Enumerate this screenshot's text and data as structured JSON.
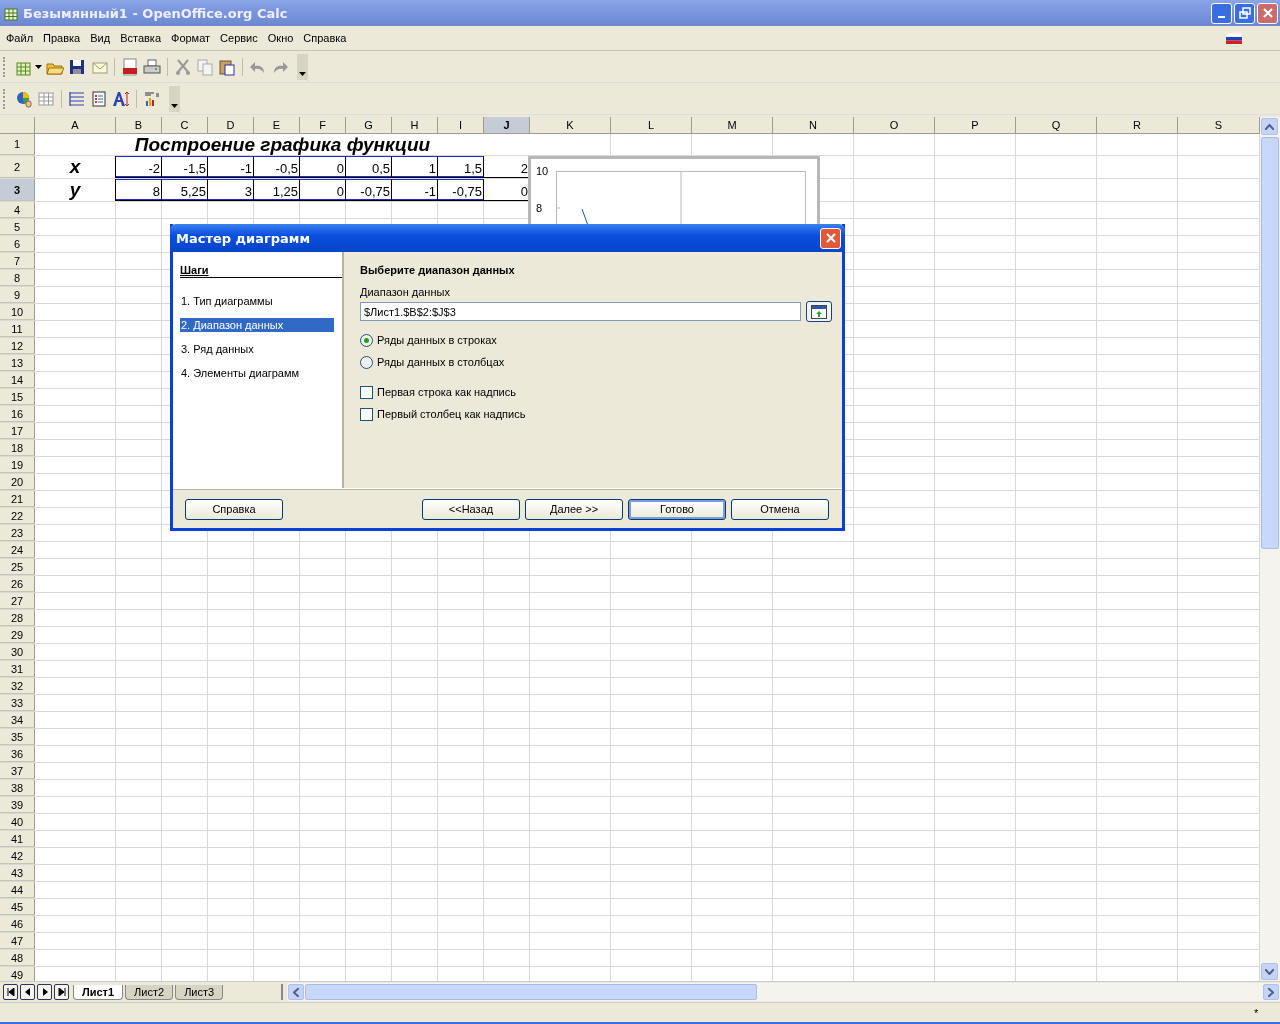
{
  "window": {
    "title": "Безымянный1 - OpenOffice.org Calc"
  },
  "menu": [
    "Файл",
    "Правка",
    "Вид",
    "Вставка",
    "Формат",
    "Сервис",
    "Окно",
    "Справка"
  ],
  "sheet": {
    "columns": [
      {
        "label": "A",
        "selected": false
      },
      {
        "label": "B",
        "selected": false
      },
      {
        "label": "C",
        "selected": false
      },
      {
        "label": "D",
        "selected": false
      },
      {
        "label": "E",
        "selected": false
      },
      {
        "label": "F",
        "selected": false
      },
      {
        "label": "G",
        "selected": false
      },
      {
        "label": "H",
        "selected": false
      },
      {
        "label": "I",
        "selected": false
      },
      {
        "label": "J",
        "selected": true
      },
      {
        "label": "K",
        "selected": false
      },
      {
        "label": "L",
        "selected": false
      },
      {
        "label": "M",
        "selected": false
      },
      {
        "label": "N",
        "selected": false
      },
      {
        "label": "O",
        "selected": false
      },
      {
        "label": "P",
        "selected": false
      },
      {
        "label": "Q",
        "selected": false
      },
      {
        "label": "R",
        "selected": false
      },
      {
        "label": "S",
        "selected": false
      }
    ],
    "rows": [
      {
        "label": "1",
        "selected": false,
        "title": "Построение графика функции"
      },
      {
        "label": "2",
        "selected": false,
        "cells": [
          {
            "text": "x",
            "in_range": false
          },
          {
            "text": "-2",
            "in_range": true
          },
          {
            "text": "-1,5",
            "in_range": true
          },
          {
            "text": "-1",
            "in_range": true
          },
          {
            "text": "-0,5",
            "in_range": true
          },
          {
            "text": "0",
            "in_range": true
          },
          {
            "text": "0,5",
            "in_range": true
          },
          {
            "text": "1",
            "in_range": true
          },
          {
            "text": "1,5",
            "in_range": true
          },
          {
            "text": "2",
            "in_range": false
          }
        ]
      },
      {
        "label": "3",
        "selected": true,
        "cells": [
          {
            "text": "y",
            "in_range": false
          },
          {
            "text": "8",
            "in_range": true
          },
          {
            "text": "5,25",
            "in_range": true
          },
          {
            "text": "3",
            "in_range": true
          },
          {
            "text": "1,25",
            "in_range": true
          },
          {
            "text": "0",
            "in_range": true
          },
          {
            "text": "-0,75",
            "in_range": true
          },
          {
            "text": "-1",
            "in_range": true
          },
          {
            "text": "-0,75",
            "in_range": true
          },
          {
            "text": "0",
            "in_range": false
          }
        ]
      },
      {
        "label": "4",
        "selected": false
      },
      {
        "label": "5",
        "selected": false
      },
      {
        "label": "6",
        "selected": false
      },
      {
        "label": "7",
        "selected": false
      },
      {
        "label": "8",
        "selected": false
      },
      {
        "label": "9",
        "selected": false
      },
      {
        "label": "10",
        "selected": false
      },
      {
        "label": "11",
        "selected": false
      },
      {
        "label": "12",
        "selected": false
      },
      {
        "label": "13",
        "selected": false
      },
      {
        "label": "14",
        "selected": false
      },
      {
        "label": "15",
        "selected": false
      },
      {
        "label": "16",
        "selected": false
      },
      {
        "label": "17",
        "selected": false
      },
      {
        "label": "18",
        "selected": false
      },
      {
        "label": "19",
        "selected": false
      },
      {
        "label": "20",
        "selected": false
      },
      {
        "label": "21",
        "selected": false
      },
      {
        "label": "22",
        "selected": false
      },
      {
        "label": "23",
        "selected": false
      },
      {
        "label": "24",
        "selected": false
      },
      {
        "label": "25",
        "selected": false
      },
      {
        "label": "26",
        "selected": false
      },
      {
        "label": "27",
        "selected": false
      },
      {
        "label": "28",
        "selected": false
      },
      {
        "label": "29",
        "selected": false
      },
      {
        "label": "30",
        "selected": false
      },
      {
        "label": "31",
        "selected": false
      },
      {
        "label": "32",
        "selected": false
      },
      {
        "label": "33",
        "selected": false
      },
      {
        "label": "34",
        "selected": false
      },
      {
        "label": "35",
        "selected": false
      },
      {
        "label": "36",
        "selected": false
      },
      {
        "label": "37",
        "selected": false
      },
      {
        "label": "38",
        "selected": false
      },
      {
        "label": "39",
        "selected": false
      },
      {
        "label": "40",
        "selected": false
      },
      {
        "label": "41",
        "selected": false
      },
      {
        "label": "42",
        "selected": false
      },
      {
        "label": "43",
        "selected": false
      },
      {
        "label": "44",
        "selected": false
      },
      {
        "label": "45",
        "selected": false
      },
      {
        "label": "46",
        "selected": false
      },
      {
        "label": "47",
        "selected": false
      },
      {
        "label": "48",
        "selected": false
      },
      {
        "label": "49",
        "selected": false
      }
    ]
  },
  "embedded_chart": {
    "tick_labels": [
      "10",
      "8"
    ]
  },
  "dialog": {
    "title": "Мастер диаграмм",
    "steps_heading": "Шаги",
    "steps": [
      {
        "label": "1.  Тип диаграммы",
        "selected": false
      },
      {
        "label": "2.  Диапазон данных",
        "selected": true
      },
      {
        "label": "3.  Ряд данных",
        "selected": false
      },
      {
        "label": "4.  Элементы диаграмм",
        "selected": false
      }
    ],
    "heading": "Выберите диапазон данных",
    "range_label": "Диапазон данных",
    "range_value": "$Лист1.$B$2:$J$3",
    "radios": [
      {
        "label": "Ряды данных в строках",
        "selected": true
      },
      {
        "label": "Ряды данных в столбцах",
        "selected": false
      }
    ],
    "checkboxes": [
      {
        "label": "Первая строка как надпись",
        "checked": false
      },
      {
        "label": "Первый столбец как надпись",
        "checked": false
      }
    ],
    "buttons": [
      {
        "label": "Справка",
        "default": false
      },
      {
        "label": "<<Назад",
        "default": false
      },
      {
        "label": "Далее >>",
        "default": false
      },
      {
        "label": "Готово",
        "default": true
      },
      {
        "label": "Отмена",
        "default": false
      }
    ]
  },
  "sheet_tabs": [
    {
      "label": "Лист1",
      "selected": true
    },
    {
      "label": "Лист2",
      "selected": false
    },
    {
      "label": "Лист3",
      "selected": false
    }
  ],
  "status_bar": {
    "modified": "*"
  }
}
